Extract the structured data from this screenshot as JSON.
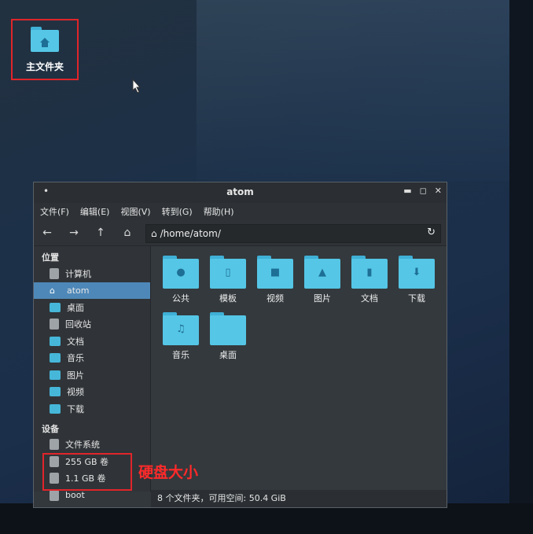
{
  "desktop": {
    "home_icon_label": "主文件夹",
    "annotation": "硬盘大小"
  },
  "window": {
    "title": "atom",
    "menu": [
      "文件(F)",
      "编辑(E)",
      "视图(V)",
      "转到(G)",
      "帮助(H)"
    ],
    "path": "/home/atom/",
    "sidebar": {
      "places_header": "位置",
      "places": [
        "计算机",
        "atom",
        "桌面",
        "回收站",
        "文档",
        "音乐",
        "图片",
        "视频",
        "下载"
      ],
      "devices_header": "设备",
      "devices": [
        "文件系统",
        "255 GB 卷",
        "1.1 GB 卷",
        "boot"
      ]
    },
    "folders": [
      {
        "label": "公共",
        "icon": "person-icon"
      },
      {
        "label": "模板",
        "icon": "template-icon"
      },
      {
        "label": "视频",
        "icon": "video-icon"
      },
      {
        "label": "图片",
        "icon": "picture-icon"
      },
      {
        "label": "文档",
        "icon": "document-icon"
      },
      {
        "label": "下载",
        "icon": "download-icon"
      },
      {
        "label": "音乐",
        "icon": "music-icon"
      },
      {
        "label": "桌面",
        "icon": "desktop-icon"
      }
    ],
    "status": "8 个文件夹，可用空间: 50.4 GiB"
  },
  "colors": {
    "folder": "#55c6e6",
    "active": "#4e88b8",
    "annotation": "#ff2a2a"
  }
}
